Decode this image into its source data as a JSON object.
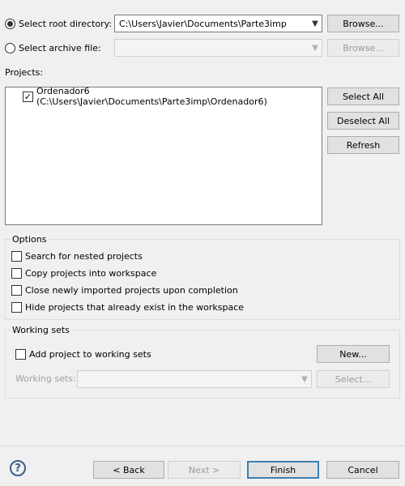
{
  "source": {
    "root_directory": {
      "label": "Select root directory:",
      "selected": true,
      "value": "C:\\Users\\Javier\\Documents\\Parte3imp",
      "browse_label": "Browse..."
    },
    "archive_file": {
      "label": "Select archive file:",
      "selected": false,
      "value": "",
      "browse_label": "Browse..."
    }
  },
  "projects": {
    "label": "Projects:",
    "items": [
      {
        "label": "Ordenador6 (C:\\Users\\Javier\\Documents\\Parte3imp\\Ordenador6)",
        "checked": true
      }
    ],
    "select_all_label": "Select All",
    "deselect_all_label": "Deselect All",
    "refresh_label": "Refresh"
  },
  "options": {
    "title": "Options",
    "items": [
      {
        "label": "Search for nested projects",
        "checked": false
      },
      {
        "label": "Copy projects into workspace",
        "checked": false
      },
      {
        "label": "Close newly imported projects upon completion",
        "checked": false
      },
      {
        "label": "Hide projects that already exist in the workspace",
        "checked": false
      }
    ]
  },
  "working_sets": {
    "title": "Working sets",
    "add_label": "Add project to working sets",
    "add_checked": false,
    "new_label": "New...",
    "sets_label": "Working sets:",
    "sets_value": "",
    "select_label": "Select..."
  },
  "footer": {
    "help_glyph": "?",
    "back_label": "< Back",
    "next_label": "Next >",
    "finish_label": "Finish",
    "cancel_label": "Cancel"
  },
  "icons": {
    "combo_arrow": "chevron-down-icon",
    "check": "checkmark-icon",
    "help": "help-icon"
  },
  "colors": {
    "background": "#f0f0f0",
    "default_button_border": "#3c7fb1",
    "help_icon": "#3a5f8a"
  }
}
